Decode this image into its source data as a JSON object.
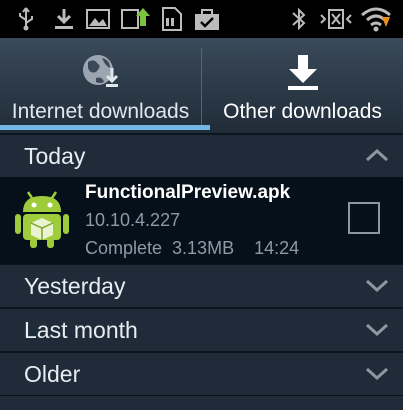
{
  "tabs": [
    {
      "label": "Internet downloads",
      "icon": "globe-download-icon",
      "selected": true
    },
    {
      "label": "Other downloads",
      "icon": "download-icon",
      "selected": false
    }
  ],
  "groups": {
    "today": {
      "label": "Today",
      "expanded": true
    },
    "yesterday": {
      "label": "Yesterday",
      "expanded": false
    },
    "last_month": {
      "label": "Last month",
      "expanded": false
    },
    "older": {
      "label": "Older",
      "expanded": false
    }
  },
  "item": {
    "name": "FunctionalPreview.apk",
    "version": "10.10.4.227",
    "status_line": "Complete  3.13MB    14:24",
    "checked": false
  },
  "status_bar_icons": [
    "usb-icon",
    "download-notification-icon",
    "image-icon",
    "share-icon",
    "sd-card-icon",
    "bag-check-icon",
    "bluetooth-icon",
    "vibrate-icon",
    "wifi-icon"
  ],
  "colors": {
    "accent": "#73b5e4",
    "android_green": "#9fcc3a"
  }
}
